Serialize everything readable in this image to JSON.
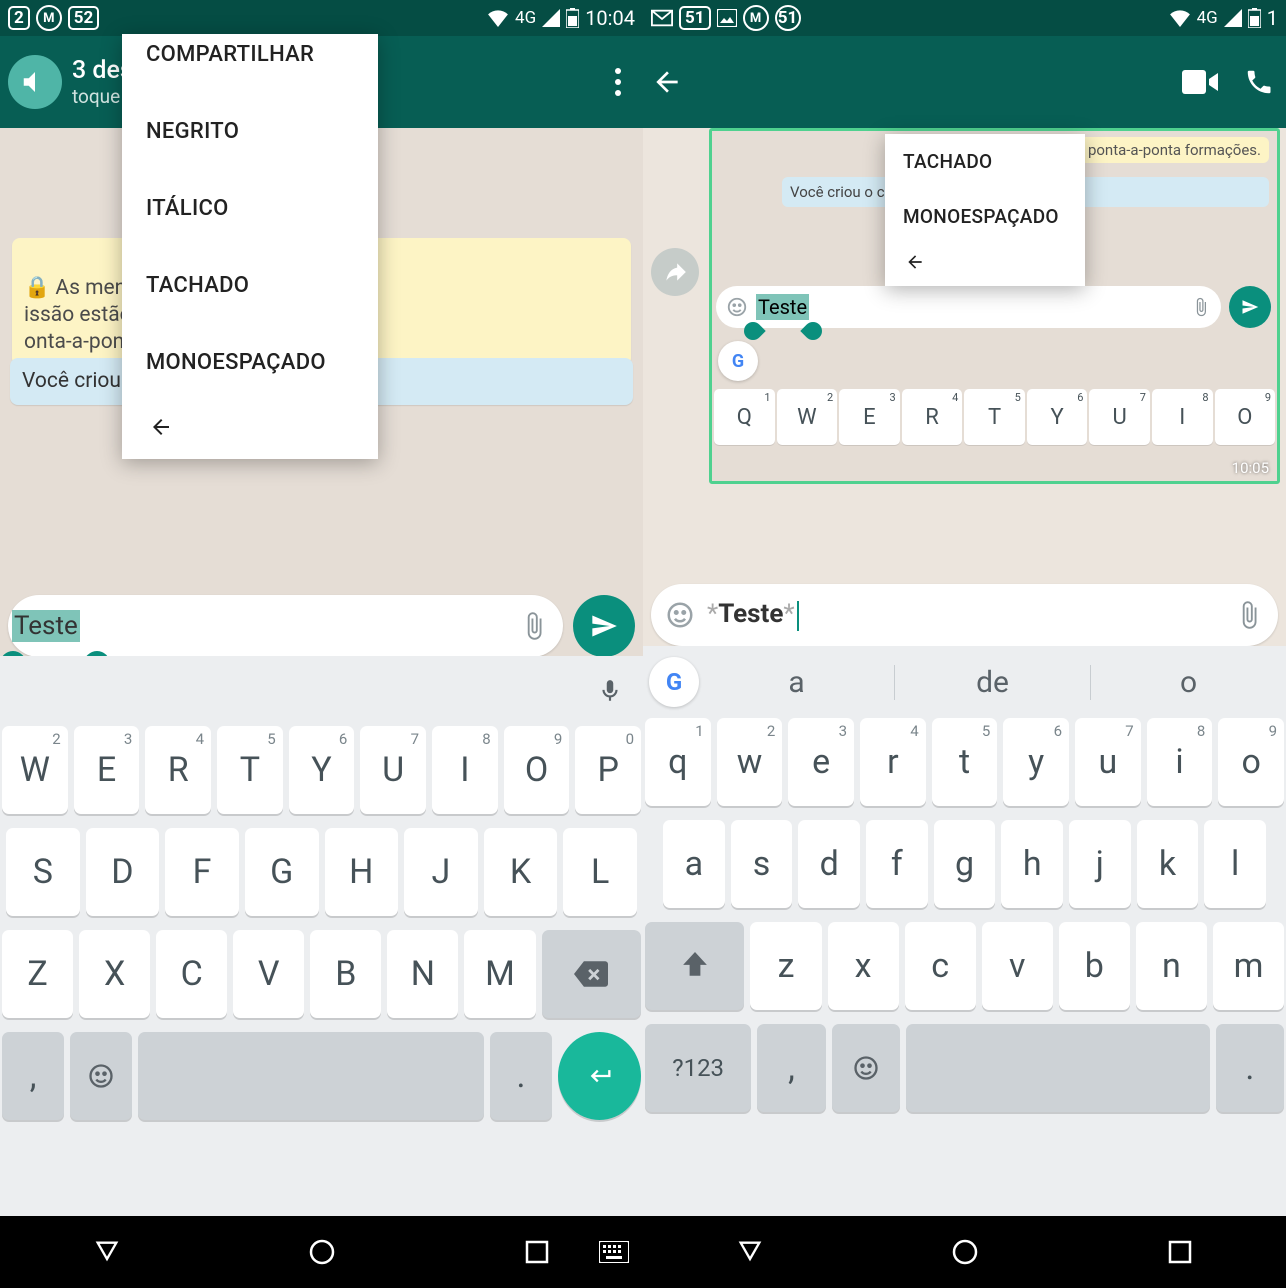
{
  "left": {
    "status": {
      "badge": "52",
      "net": "4G",
      "time": "10:04",
      "left_num": "2"
    },
    "appbar": {
      "title": "3 des",
      "subtitle": "toque p"
    },
    "context_menu": [
      "COMPARTILHAR",
      "NEGRITO",
      "ITÁLICO",
      "TACHADO",
      "MONOESPAÇADO"
    ],
    "encrypt_msg": "As mensag                                sta de trans-\nissão estão                                 ptografia de\nonta-a-ponta                                    formações.",
    "info_msg": "Você criou                                   o com 3",
    "input_text": "Teste",
    "keyboard": {
      "row1": [
        {
          "k": "W",
          "n": "2"
        },
        {
          "k": "E",
          "n": "3"
        },
        {
          "k": "R",
          "n": "4"
        },
        {
          "k": "T",
          "n": "5"
        },
        {
          "k": "Y",
          "n": "6"
        },
        {
          "k": "U",
          "n": "7"
        },
        {
          "k": "I",
          "n": "8"
        },
        {
          "k": "O",
          "n": "9"
        },
        {
          "k": "P",
          "n": "0"
        }
      ],
      "row2": [
        "S",
        "D",
        "F",
        "G",
        "H",
        "J",
        "K",
        "L"
      ],
      "row3": [
        "Z",
        "X",
        "C",
        "V",
        "B",
        "N",
        "M"
      ]
    }
  },
  "right": {
    "status": {
      "badge": "51",
      "badge2": "51",
      "net": "4G",
      "time": "1"
    },
    "thumb": {
      "msg1": "ponta-a-ponta                   formações.",
      "msg2": "Você criou                       o com 3",
      "ctx": [
        "TACHADO",
        "MONOESPAÇADO"
      ],
      "input": "Teste",
      "time": "10:05",
      "row": [
        {
          "k": "Q",
          "n": "1"
        },
        {
          "k": "W",
          "n": "2"
        },
        {
          "k": "E",
          "n": "3"
        },
        {
          "k": "R",
          "n": "4"
        },
        {
          "k": "T",
          "n": "5"
        },
        {
          "k": "Y",
          "n": "6"
        },
        {
          "k": "U",
          "n": "7"
        },
        {
          "k": "I",
          "n": "8"
        },
        {
          "k": "O",
          "n": "9"
        }
      ]
    },
    "input_text": "Teste",
    "suggestions": [
      "a",
      "de",
      "o"
    ],
    "keyboard": {
      "row1": [
        {
          "k": "q",
          "n": "1"
        },
        {
          "k": "w",
          "n": "2"
        },
        {
          "k": "e",
          "n": "3"
        },
        {
          "k": "r",
          "n": "4"
        },
        {
          "k": "t",
          "n": "5"
        },
        {
          "k": "y",
          "n": "6"
        },
        {
          "k": "u",
          "n": "7"
        },
        {
          "k": "i",
          "n": "8"
        },
        {
          "k": "o",
          "n": "9"
        }
      ],
      "row2": [
        "a",
        "s",
        "d",
        "f",
        "g",
        "h",
        "j",
        "k",
        "l"
      ],
      "row3": [
        "z",
        "x",
        "c",
        "v",
        "b",
        "n",
        "m"
      ],
      "sym": "?123"
    }
  }
}
